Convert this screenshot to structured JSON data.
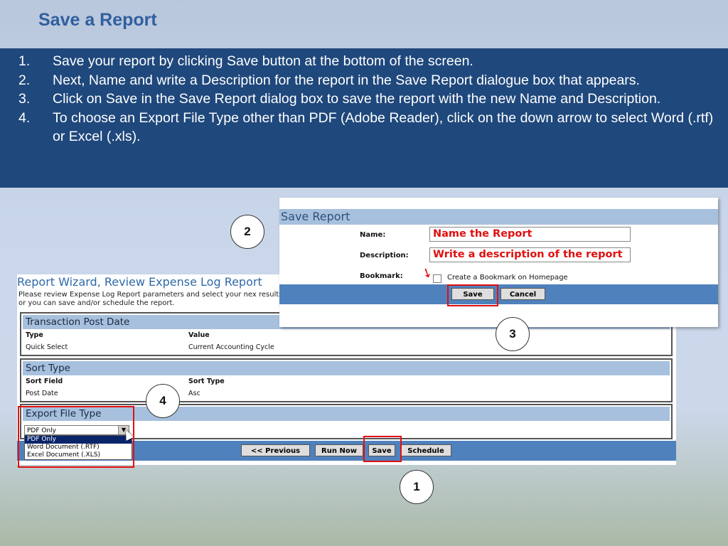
{
  "slide": {
    "title": "Save a Report",
    "steps": [
      {
        "num": "1.",
        "text": "Save your report by clicking Save button at the bottom of the screen."
      },
      {
        "num": "2.",
        "text": "Next, Name and write a Description for the report in the Save Report dialogue box that appears."
      },
      {
        "num": "3.",
        "text": "Click on Save in the Save Report dialog box to save the report with the new Name and Description."
      },
      {
        "num": "4.",
        "text": "To choose an Export File Type other than PDF (Adobe Reader), click on the down arrow to select Word (.rtf) or Excel (.xls)."
      }
    ]
  },
  "wizard": {
    "title": "Report Wizard, Review Expense Log Report",
    "description": "Please review Expense Log Report parameters and select your nex results, or you can save and/or schedule the report.",
    "sections": [
      {
        "title": "Transaction Post Date",
        "col1_header": "Type",
        "col2_header": "Value",
        "col1_value": "Quick Select",
        "col2_value": "Current Accounting Cycle"
      },
      {
        "title": "Sort Type",
        "col1_header": "Sort Field",
        "col2_header": "Sort Type",
        "col1_value": "Post Date",
        "col2_value": "Asc"
      }
    ],
    "export": {
      "title": "Export File Type",
      "selected": "PDF Only",
      "options": [
        "PDF Only",
        "Word Document (.RTF)",
        "Excel Document (.XLS)"
      ]
    },
    "buttons": {
      "previous": "<< Previous",
      "run_now": "Run Now",
      "save": "Save",
      "schedule": "Schedule"
    }
  },
  "dialog": {
    "title": "Save Report",
    "name_label": "Name:",
    "name_value": "Name the Report",
    "description_label": "Description:",
    "description_value": "Write a description of the report",
    "bookmark_label": "Bookmark:",
    "bookmark_checkbox_label": "Create a Bookmark on Homepage",
    "save": "Save",
    "cancel": "Cancel"
  },
  "callouts": {
    "c1": "1",
    "c2": "2",
    "c3": "3",
    "c4": "4"
  },
  "colors": {
    "title": "#2f5f9e",
    "instruction_bg": "#1f487c",
    "highlight": "#e01010",
    "bar": "#4f81bd",
    "section_head": "#a7c0de"
  }
}
